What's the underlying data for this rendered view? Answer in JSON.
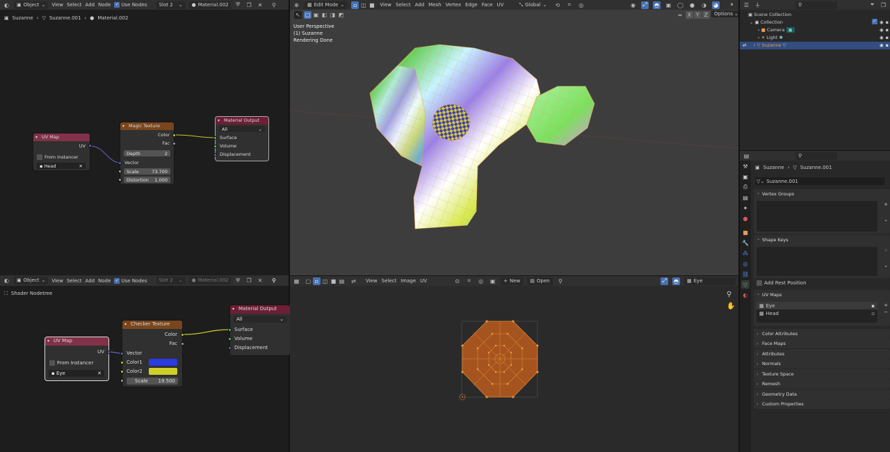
{
  "top_shader": {
    "header": {
      "mode": "Object",
      "menus": [
        "View",
        "Select",
        "Add",
        "Node"
      ],
      "use_nodes": "Use Nodes",
      "slot": "Slot 2",
      "material": "Material.002"
    },
    "breadcrumb": [
      "Suzanne",
      "Suzanne.001",
      "Material.002"
    ],
    "uv_map": {
      "title": "UV Map",
      "out": "UV",
      "from_instancer": "From Instancer",
      "map": "Head"
    },
    "magic": {
      "title": "Magic Texture",
      "color": "Color",
      "fac": "Fac",
      "depth_label": "Depth",
      "depth": "2",
      "vector": "Vector",
      "scale_label": "Scale",
      "scale": "73.700",
      "distortion_label": "Distortion",
      "distortion": "1.000"
    },
    "output": {
      "title": "Material Output",
      "target": "All",
      "surface": "Surface",
      "volume": "Volume",
      "displacement": "Displacement"
    }
  },
  "bottom_shader": {
    "header": {
      "mode": "Object",
      "menus": [
        "View",
        "Select",
        "Add",
        "Node"
      ],
      "use_nodes": "Use Nodes",
      "slot": "Slot 2",
      "material": "Material.002"
    },
    "breadcrumb": "Shader Nodetree",
    "uv_map": {
      "title": "UV Map",
      "out": "UV",
      "from_instancer": "From Instancer",
      "map": "Eye"
    },
    "checker": {
      "title": "Checker Texture",
      "color": "Color",
      "fac": "Fac",
      "vector": "Vector",
      "color1": "Color1",
      "color2": "Color2",
      "scale_label": "Scale",
      "scale": "19.500",
      "color1_hex": "#2a3ce0",
      "color2_hex": "#cfcf2a"
    },
    "output": {
      "title": "Material Output",
      "target": "All",
      "surface": "Surface",
      "volume": "Volume",
      "displacement": "Displacement"
    }
  },
  "viewport": {
    "mode": "Edit Mode",
    "menus": [
      "View",
      "Select",
      "Add",
      "Mesh",
      "Vertex",
      "Edge",
      "Face",
      "UV"
    ],
    "orientation": "Global",
    "axes": [
      "X",
      "Y",
      "Z"
    ],
    "options": "Options",
    "overlay": [
      "User Perspective",
      "(1) Suzanne",
      "Rendering Done"
    ]
  },
  "uv_editor": {
    "menus": [
      "View",
      "Select",
      "Image",
      "UV"
    ],
    "new": "New",
    "open": "Open",
    "uv_map": "Eye"
  },
  "outliner": {
    "root": "Scene Collection",
    "collection": "Collection",
    "items": [
      "Camera",
      "Light",
      "Suzanne"
    ]
  },
  "properties": {
    "breadcrumb": [
      "Suzanne",
      "Suzanne.001"
    ],
    "mesh_name": "Suzanne.001",
    "vertex_groups": "Vertex Groups",
    "shape_keys": "Shape Keys",
    "add_rest_position": "Add Rest Position",
    "uv_maps": "UV Maps",
    "uv_list": [
      "Eye",
      "Head"
    ],
    "collapsed": [
      "Color Attributes",
      "Face Maps",
      "Attributes",
      "Normals",
      "Texture Space",
      "Remesh",
      "Geometry Data",
      "Custom Properties"
    ]
  },
  "colors": {
    "accent": "#4772b3",
    "node_input_header": "#83314a",
    "node_texture_header": "#79461d",
    "node_output_header": "#6e1f37",
    "selected_orange": "#e08a2c"
  }
}
